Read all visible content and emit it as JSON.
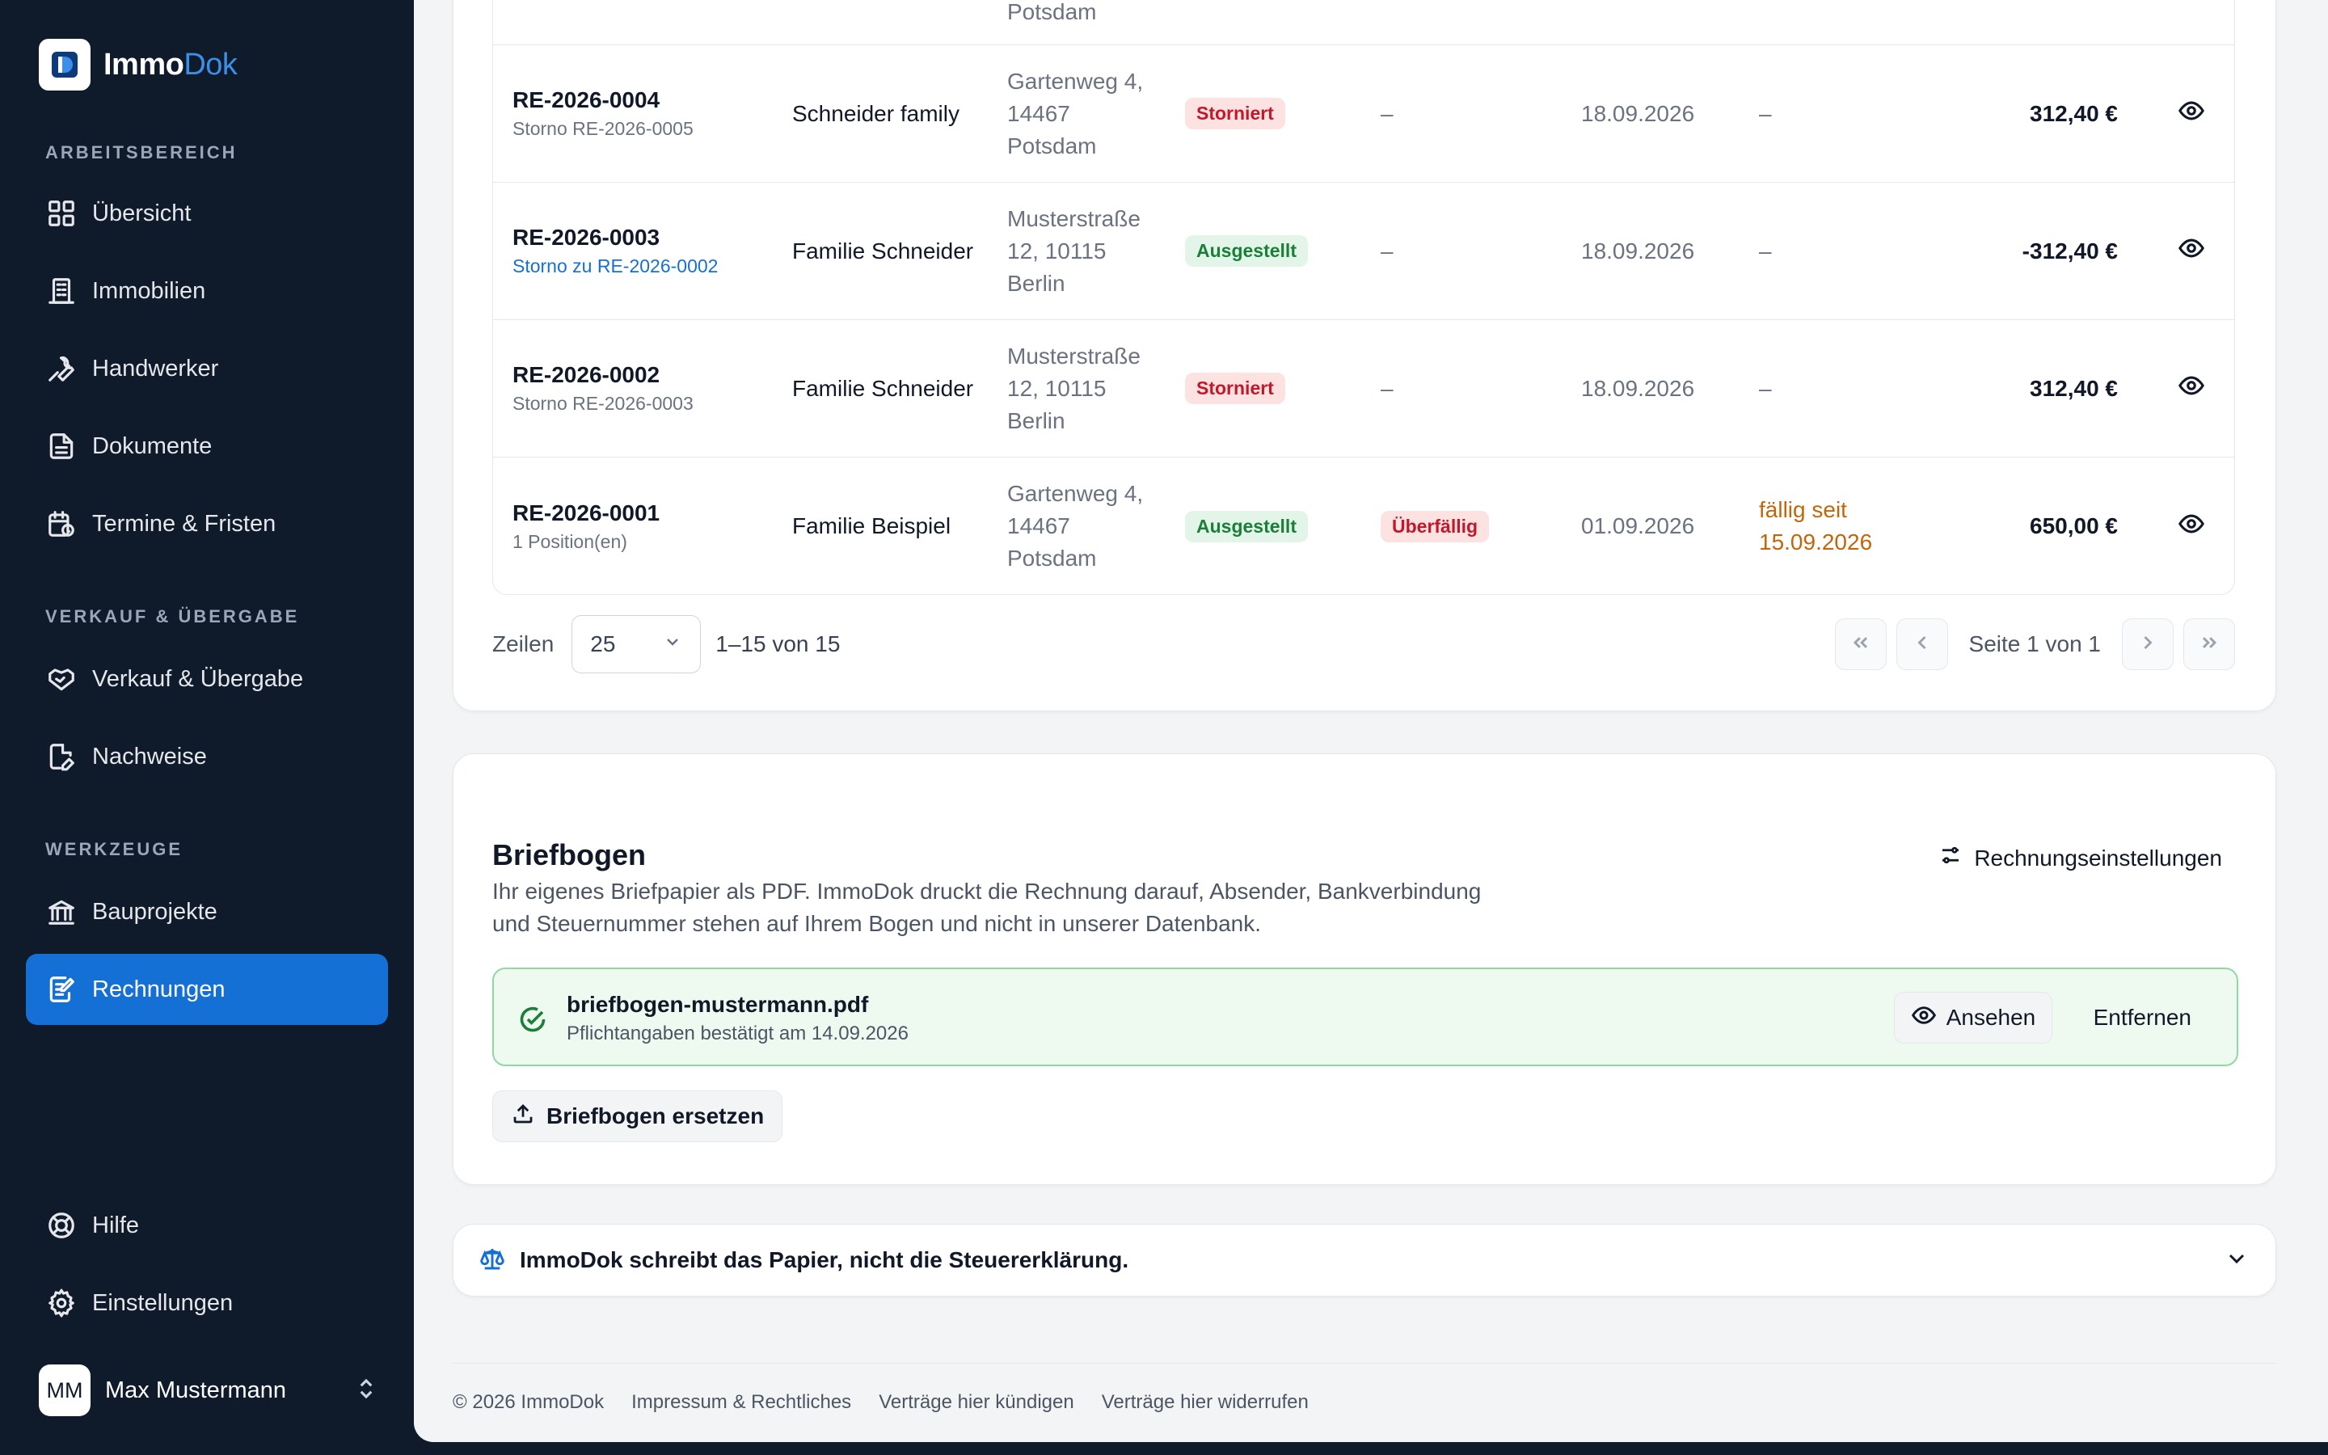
{
  "brand": {
    "name_main": "Immo",
    "name_accent": "Dok"
  },
  "sidebar": {
    "sections": {
      "workspace": "ARBEITSBEREICH",
      "sale": "VERKAUF & ÜBERGABE",
      "tools": "WERKZEUGE"
    },
    "items": [
      {
        "label": "Übersicht",
        "icon": "grid-icon"
      },
      {
        "label": "Immobilien",
        "icon": "building-icon"
      },
      {
        "label": "Handwerker",
        "icon": "wrench-icon"
      },
      {
        "label": "Dokumente",
        "icon": "document-icon"
      },
      {
        "label": "Termine & Fristen",
        "icon": "calendar-clock-icon"
      },
      {
        "label": "Verkauf & Übergabe",
        "icon": "handshake-icon"
      },
      {
        "label": "Nachweise",
        "icon": "file-edit-icon"
      },
      {
        "label": "Bauprojekte",
        "icon": "bank-icon"
      },
      {
        "label": "Rechnungen",
        "icon": "receipt-edit-icon",
        "active": true
      },
      {
        "label": "Hilfe",
        "icon": "lifebuoy-icon"
      },
      {
        "label": "Einstellungen",
        "icon": "gear-icon"
      }
    ],
    "user": {
      "initials": "MM",
      "name": "Max Mustermann"
    }
  },
  "table": {
    "partial_row": {
      "addr": "Potsdam"
    },
    "rows": [
      {
        "number": "RE-2026-0004",
        "sub": "Storno RE-2026-0005",
        "sub_link": false,
        "customer": "Schneider family",
        "addr": "Gartenweg 4, 14467 Potsdam",
        "status": "Storniert",
        "status_color": "red",
        "due": "–",
        "date": "18.09.2026",
        "paid": "–",
        "amount": "312,40 €"
      },
      {
        "number": "RE-2026-0003",
        "sub": "Storno zu RE-2026-0002",
        "sub_link": true,
        "customer": "Familie Schneider",
        "addr": "Musterstraße 12, 10115 Berlin",
        "status": "Ausgestellt",
        "status_color": "green",
        "due": "–",
        "date": "18.09.2026",
        "paid": "–",
        "amount": "-312,40 €"
      },
      {
        "number": "RE-2026-0002",
        "sub": "Storno RE-2026-0003",
        "sub_link": false,
        "customer": "Familie Schneider",
        "addr": "Musterstraße 12, 10115 Berlin",
        "status": "Storniert",
        "status_color": "red",
        "due": "–",
        "date": "18.09.2026",
        "paid": "–",
        "amount": "312,40 €"
      },
      {
        "number": "RE-2026-0001",
        "sub": "1 Position(en)",
        "sub_link": false,
        "customer": "Familie Beispiel",
        "addr": "Gartenweg 4, 14467 Potsdam",
        "status": "Ausgestellt",
        "status_color": "green",
        "due": "Überfällig",
        "date": "01.09.2026",
        "paid": "fällig seit 15.09.2026",
        "paid_warn": true,
        "amount": "650,00 €"
      }
    ]
  },
  "pager": {
    "rows_label": "Zeilen",
    "rows_value": "25",
    "range": "1–15 von 15",
    "page_text": "Seite 1 von 1"
  },
  "brief": {
    "title": "Briefbogen",
    "desc": "Ihr eigenes Briefpapier als PDF. ImmoDok druckt die Rechnung darauf, Absender, Bankverbindung und Steuernummer stehen auf Ihrem Bogen und nicht in unserer Datenbank.",
    "settings_label": "Rechnungseinstellungen",
    "file_name": "briefbogen-mustermann.pdf",
    "file_sub": "Pflichtangaben bestätigt am 14.09.2026",
    "view_label": "Ansehen",
    "remove_label": "Entfernen",
    "replace_label": "Briefbogen ersetzen"
  },
  "accordion": {
    "text": "ImmoDok schreibt das Papier, nicht die Steuererklärung."
  },
  "footer": {
    "copyright": "© 2026 ImmoDok",
    "links": [
      "Impressum & Rechtliches",
      "Verträge hier kündigen",
      "Verträge hier widerrufen"
    ]
  },
  "colors": {
    "sidebar_bg": "#0f1a2b",
    "accent": "#1570d6",
    "red_badge": "#c2182b",
    "green_badge": "#1a7f37",
    "warn": "#c2660a"
  }
}
